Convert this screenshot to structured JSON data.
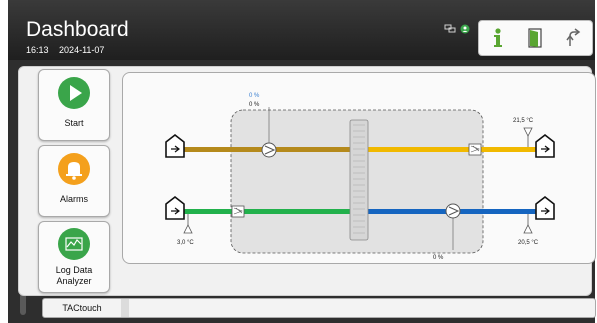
{
  "header": {
    "title": "Dashboard",
    "time": "16:13",
    "date": "2024-11-07",
    "status_icons": [
      "network-icon",
      "user-status-icon"
    ],
    "buttons": [
      {
        "name": "info-button",
        "icon": "info-icon"
      },
      {
        "name": "door-button",
        "icon": "door-icon"
      },
      {
        "name": "back-button",
        "icon": "back-arrow-icon"
      }
    ]
  },
  "nav": {
    "start_label": "Start",
    "alarms_label": "Alarms",
    "log_label_line1": "Log Data",
    "log_label_line2": "Analyzer"
  },
  "diagram": {
    "top_pct_blue": "0 %",
    "top_pct_black": "0 %",
    "supply_temp": "21,5 °C",
    "outdoor_temp": "3,0 °C",
    "exhaust_temp": "20,5 °C",
    "bottom_pct_black": "0 %",
    "bottom_pct_blue": "0 %"
  },
  "footer": {
    "tab_label": "TACtouch"
  },
  "colors": {
    "extract_duct": "#b58a1c",
    "supply_duct_warm": "#f1b900",
    "outdoor_duct": "#22b14c",
    "exhaust_duct": "#1565c0",
    "start_icon": "#3aa54a",
    "alarm_icon": "#f4a01c",
    "log_icon": "#3aa54a",
    "info_icon": "#5aa632",
    "door_icon": "#5aa632"
  }
}
